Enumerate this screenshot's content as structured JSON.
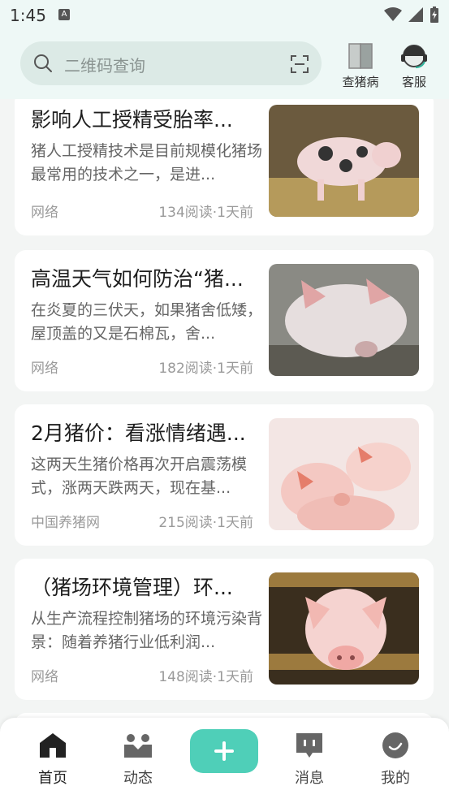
{
  "status": {
    "time": "1:45",
    "notif": "A"
  },
  "search": {
    "placeholder": "二维码查询"
  },
  "header": {
    "disease_label": "查猪病",
    "service_label": "客服"
  },
  "articles": [
    {
      "title": "影响人工授精受胎率...",
      "summary": "猪人工授精技术是目前规模化猪场最常用的技术之一，是进...",
      "source": "网络",
      "meta": "134阅读·1天前"
    },
    {
      "title": "高温天气如何防治“猪...",
      "summary": "在炎夏的三伏天，如果猪舍低矮，屋顶盖的又是石棉瓦，舍...",
      "source": "网络",
      "meta": "182阅读·1天前"
    },
    {
      "title": "2月猪价：看涨情绪遇...",
      "summary": "这两天生猪价格再次开启震荡模式，涨两天跌两天，现在基...",
      "source": "中国养猪网",
      "meta": "215阅读·1天前"
    },
    {
      "title": "（猪场环境管理）环...",
      "summary": "从生产流程控制猪场的环境污染背景：随着养猪行业低利润...",
      "source": "网络",
      "meta": "148阅读·1天前"
    }
  ],
  "tabs": {
    "home": "首页",
    "feed": "动态",
    "messages": "消息",
    "mine": "我的"
  },
  "colors": {
    "accent": "#4fcfb8",
    "header_bg": "#eef8f6"
  }
}
